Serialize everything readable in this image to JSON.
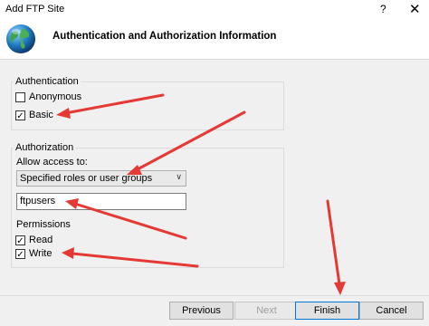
{
  "window": {
    "title": "Add FTP Site",
    "help": "?",
    "close": "✕"
  },
  "header": {
    "title": "Authentication and Authorization Information"
  },
  "authentication": {
    "legend": "Authentication",
    "anonymous": {
      "label": "Anonymous",
      "checked": false
    },
    "basic": {
      "label": "Basic",
      "checked": true
    }
  },
  "authorization": {
    "legend": "Authorization",
    "allow_label": "Allow access to:",
    "allow_value": "Specified roles or user groups",
    "users_value": "ftpusers",
    "permissions_label": "Permissions",
    "read": {
      "label": "Read",
      "checked": true
    },
    "write": {
      "label": "Write",
      "checked": true
    }
  },
  "buttons": {
    "previous": "Previous",
    "next": "Next",
    "finish": "Finish",
    "cancel": "Cancel"
  },
  "annotation_color": "#e53935"
}
